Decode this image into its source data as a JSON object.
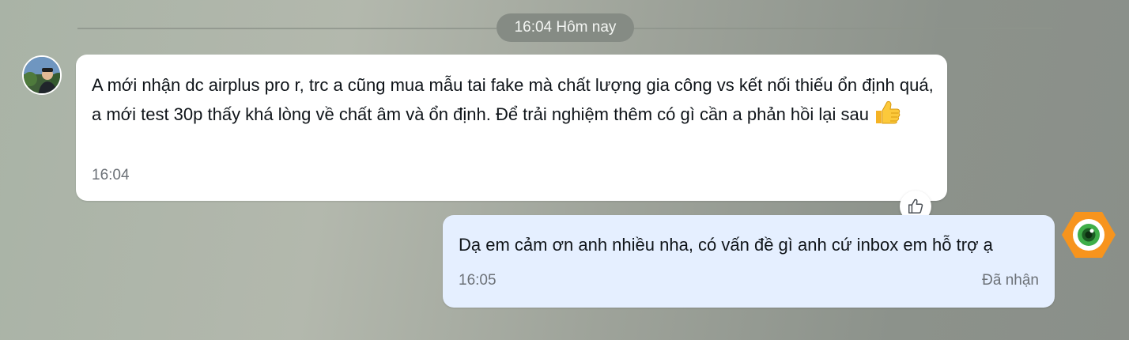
{
  "date_divider": {
    "label": "16:04 Hôm nay"
  },
  "incoming": {
    "text": "A mới nhận dc airplus pro r, trc a cũng mua mẫu tai fake mà chất lượng gia công vs kết nối thiếu ổn định quá, a mới test 30p thấy khá lòng về chất âm và ổn định. Để trải nghiệm thêm có gì cần a phản hồi lại sau",
    "emoji": "thumbs-up-emoji",
    "time": "16:04"
  },
  "outgoing": {
    "text": "Dạ em cảm ơn anh nhiều nha, có vấn đề gì anh cứ inbox em hỗ trợ ạ",
    "time": "16:05",
    "status": "Đã nhận"
  },
  "reaction": {
    "icon": "thumbs-up-outline-icon"
  },
  "colors": {
    "incoming_bubble": "#ffffff",
    "outgoing_bubble": "#e5efff",
    "brand_orange": "#f7941d",
    "brand_green": "#3fae49"
  }
}
